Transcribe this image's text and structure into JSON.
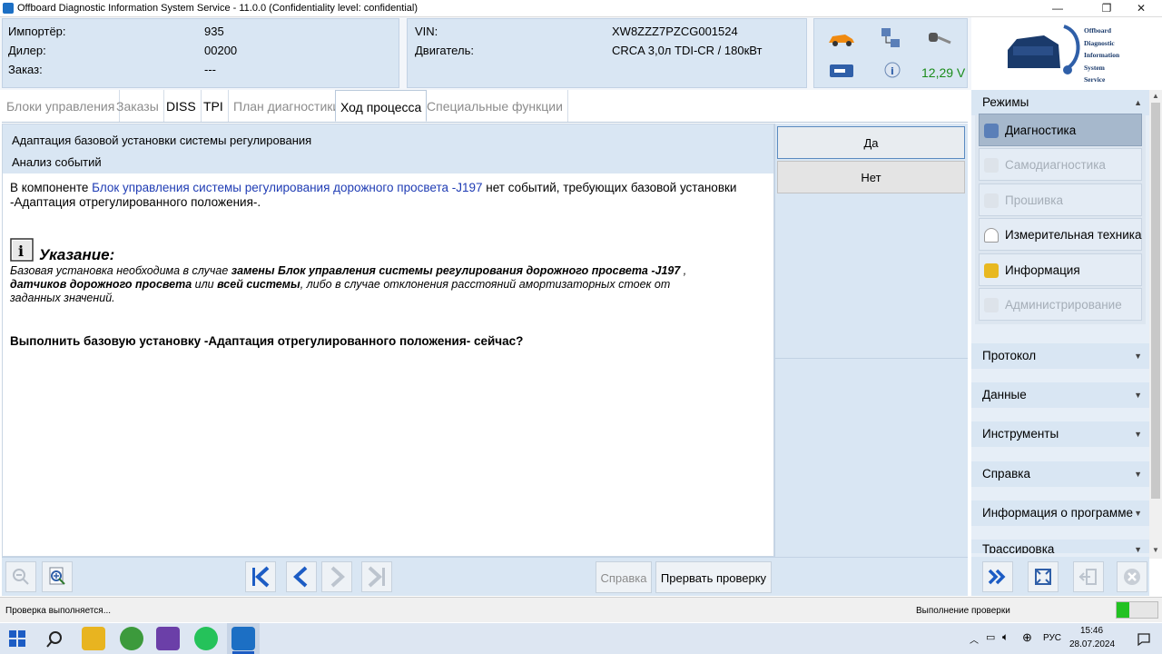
{
  "window": {
    "title": "Offboard Diagnostic Information System Service - 11.0.0 (Confidentiality level: confidential)",
    "minimize": "—",
    "restore": "❐",
    "close": "✕"
  },
  "header": {
    "importer_label": "Импортёр:",
    "importer_value": "935",
    "dealer_label": "Дилер:",
    "dealer_value": "00200",
    "order_label": "Заказ:",
    "order_value": "---",
    "vin_label": "VIN:",
    "vin_value": "XW8ZZZ7PZCG001524",
    "engine_label": "Двигатель:",
    "engine_value": "CRCA 3,0л TDI-CR / 180кВт",
    "voltage": "12,29 V",
    "logo_lines": [
      "Offboard",
      "Diagnostic",
      "Information",
      "System",
      "Service"
    ]
  },
  "tabs": [
    {
      "label": "Блоки управления",
      "state": "disabled"
    },
    {
      "label": "Заказы",
      "state": "disabled"
    },
    {
      "label": "DISS",
      "state": "normal"
    },
    {
      "label": "TPI",
      "state": "normal"
    },
    {
      "label": "План диагностики",
      "state": "disabled"
    },
    {
      "label": "Ход процесса",
      "state": "active"
    },
    {
      "label": "Специальные функции",
      "state": "disabled"
    }
  ],
  "content": {
    "title": "Адаптация базовой установки системы регулирования",
    "subtitle": "Анализ событий",
    "msg_part1": "В компоненте ",
    "msg_link": "Блок управления системы регулирования дорожного просвета -J197",
    "msg_part2": " нет событий, требующих базовой установки",
    "msg_line2": "-Адаптация отрегулированного положения-.",
    "note_heading": "Указание:",
    "note_p1": "Базовая установка необходима в случае ",
    "note_b1": "замены Блок управления системы регулирования дорожного просвета -J197",
    "note_p2": " ,",
    "note_b2": "датчиков дорожного просвета",
    "note_p3": " или ",
    "note_b3": "всей системы",
    "note_p4": ", либо в случае отклонения расстояний амортизаторных стоек от",
    "note_p5": "заданных значений.",
    "question": "Выполнить базовую установку -Адаптация отрегулированного положения- сейчас?"
  },
  "answers": {
    "yes": "Да",
    "no": "Нет"
  },
  "toolbar": {
    "help_label": "Справка",
    "abort_label": "Прервать проверку"
  },
  "sidebar": {
    "modes_label": "Режимы",
    "items": [
      {
        "label": "Диагностика",
        "state": "selected"
      },
      {
        "label": "Самодиагностика",
        "state": "disabled"
      },
      {
        "label": "Прошивка",
        "state": "disabled"
      },
      {
        "label": "Измерительная техника",
        "state": "normal"
      },
      {
        "label": "Информация",
        "state": "normal"
      },
      {
        "label": "Администрирование",
        "state": "disabled"
      }
    ],
    "sections": [
      "Протокол",
      "Данные",
      "Инструменты",
      "Справка",
      "Информация о программе",
      "Трассировка"
    ]
  },
  "status": {
    "left": "Проверка выполняется...",
    "right": "Выполнение проверки",
    "progress_fraction": 0.3
  },
  "taskbar": {
    "lang": "РУС",
    "time": "15:46",
    "date": "28.07.2024"
  },
  "colors": {
    "panel": "#d9e6f3",
    "link": "#1f3cb4",
    "voltage": "#1a8c1a",
    "progress": "#22c222"
  }
}
